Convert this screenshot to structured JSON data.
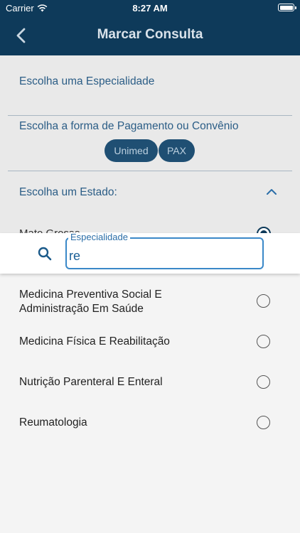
{
  "status_bar": {
    "carrier": "Carrier",
    "time": "8:27 AM"
  },
  "app_bar": {
    "title": "Marcar Consulta",
    "back_icon": "chevron-left-icon"
  },
  "form": {
    "specialty_label": "Escolha uma Especialidade",
    "payment_label": "Escolha a forma de Pagamento ou Convênio",
    "payment_options": [
      "Unimed",
      "PAX"
    ],
    "state_label": "Escolha um Estado:",
    "state_selected": "Mato Grosso"
  },
  "search": {
    "label": "Especialidade",
    "value": "re",
    "icon": "search-icon"
  },
  "results": [
    {
      "label_line1": "Medicina Preventiva Social E",
      "label_line2": "Administração Em Saúde"
    },
    {
      "label_line1": "Medicina Física E Reabilitação",
      "label_line2": ""
    },
    {
      "label_line1": "Nutrição Parenteral E Enteral",
      "label_line2": ""
    },
    {
      "label_line1": "Reumatologia",
      "label_line2": ""
    }
  ],
  "colors": {
    "primary": "#0e3a5a",
    "accent": "#3a88c8"
  }
}
